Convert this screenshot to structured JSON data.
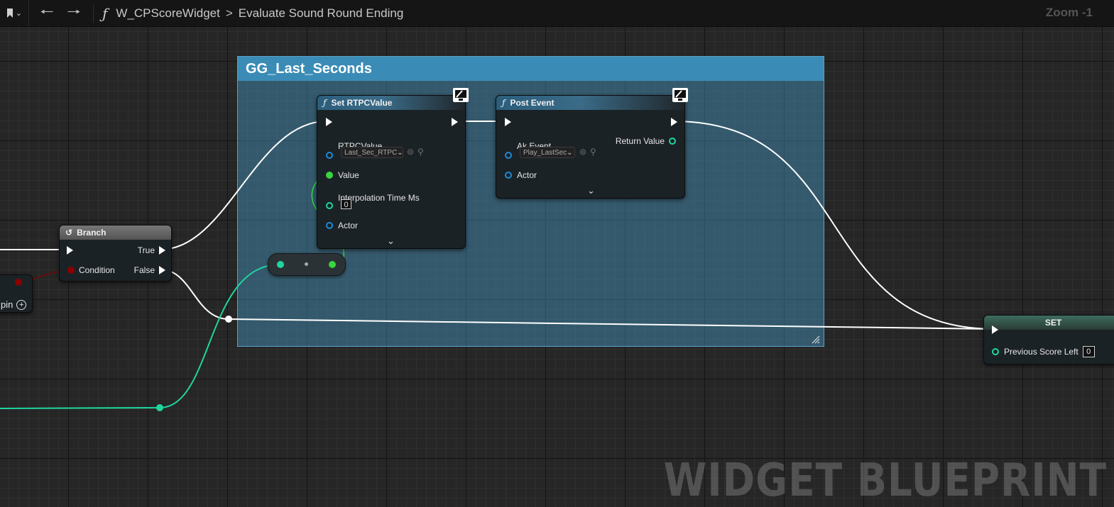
{
  "toolbar": {
    "bookmark_icon": "bookmark-icon",
    "back_icon": "arrow-left-icon",
    "forward_icon": "arrow-right-icon",
    "function_glyph": "ƒ",
    "breadcrumb_blueprint": "W_CPScoreWidget",
    "breadcrumb_separator": ">",
    "breadcrumb_function": "Evaluate Sound Round Ending",
    "zoom": "Zoom -1"
  },
  "comment_box": {
    "title": "GG_Last_Seconds",
    "color": "#3a8cb6"
  },
  "nodes": {
    "branch": {
      "title": "Branch",
      "pins": {
        "true": "True",
        "false": "False",
        "condition": "Condition"
      }
    },
    "set_rtpc": {
      "title": "Set RTPCValue",
      "pins": {
        "rtpc_value": "RTPCValue",
        "rtpc_dropdown": "Last_Sec_RTPC",
        "value": "Value",
        "interpolation": "Interpolation Time Ms",
        "interpolation_value": "0",
        "actor": "Actor"
      }
    },
    "post_event": {
      "title": "Post Event",
      "pins": {
        "ak_event": "Ak Event",
        "ak_event_dropdown": "Play_LastSec",
        "return_value": "Return Value",
        "actor": "Actor"
      }
    },
    "set_var": {
      "title": "SET",
      "pins": {
        "previous_score_left": "Previous Score Left",
        "previous_score_value": "0"
      }
    },
    "offscreen_pin": {
      "label": "pin"
    }
  },
  "pin_colors": {
    "exec": "#ffffff",
    "bool": "#8c0000",
    "float": "#39d43f",
    "int": "#1fd6a0",
    "object": "#1d8ad6"
  },
  "watermark": "WIDGET BLUEPRINT"
}
